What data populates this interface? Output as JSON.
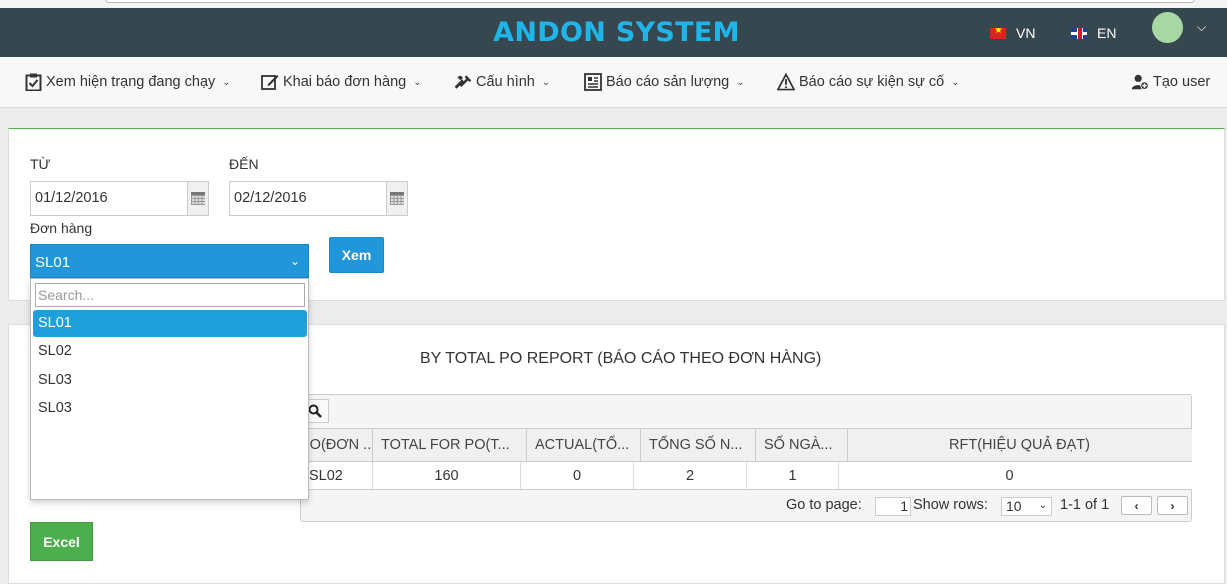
{
  "header": {
    "title": "ANDON SYSTEM",
    "lang_vn": "VN",
    "lang_en": "EN",
    "title_color": "#1fb5e9",
    "bg_color": "#37474f"
  },
  "nav": {
    "items": [
      {
        "label": "Xem hiện trạng đang chạy",
        "icon": "clipboard-check-icon"
      },
      {
        "label": "Khai báo đơn hàng",
        "icon": "edit-icon"
      },
      {
        "label": "Cấu hình",
        "icon": "tools-icon"
      },
      {
        "label": "Báo cáo sản lượng",
        "icon": "report-icon"
      },
      {
        "label": "Báo cáo sự kiện sự cố",
        "icon": "warning-icon"
      }
    ],
    "create_user": "Tạo user"
  },
  "filter": {
    "from_label": "TỪ",
    "from_value": "01/12/2016",
    "to_label": "ĐẾN",
    "to_value": "02/12/2016",
    "order_label": "Đơn hàng",
    "order_selected": "SL01",
    "view_button": "Xem",
    "search_placeholder": "Search...",
    "options": [
      "SL01",
      "SL02",
      "SL03",
      "SL03"
    ]
  },
  "report": {
    "title": "BY TOTAL PO REPORT (BÁO CÁO THEO ĐƠN HÀNG)",
    "columns": [
      "PO(ĐƠN ...",
      "TOTAL FOR PO(T...",
      "ACTUAL(TỔ...",
      "TỔNG SỐ N...",
      "SỐ NGÀ...",
      "RFT(HIỆU QUẢ ĐẠT)"
    ],
    "rows": [
      [
        "SL02",
        "160",
        "0",
        "2",
        "1",
        "0"
      ]
    ],
    "go_to_page_label": "Go to page:",
    "page_value": "1",
    "show_rows_label": "Show rows:",
    "rows_value": "10",
    "range_text": "1-1 of 1"
  },
  "excel_button": "Excel"
}
